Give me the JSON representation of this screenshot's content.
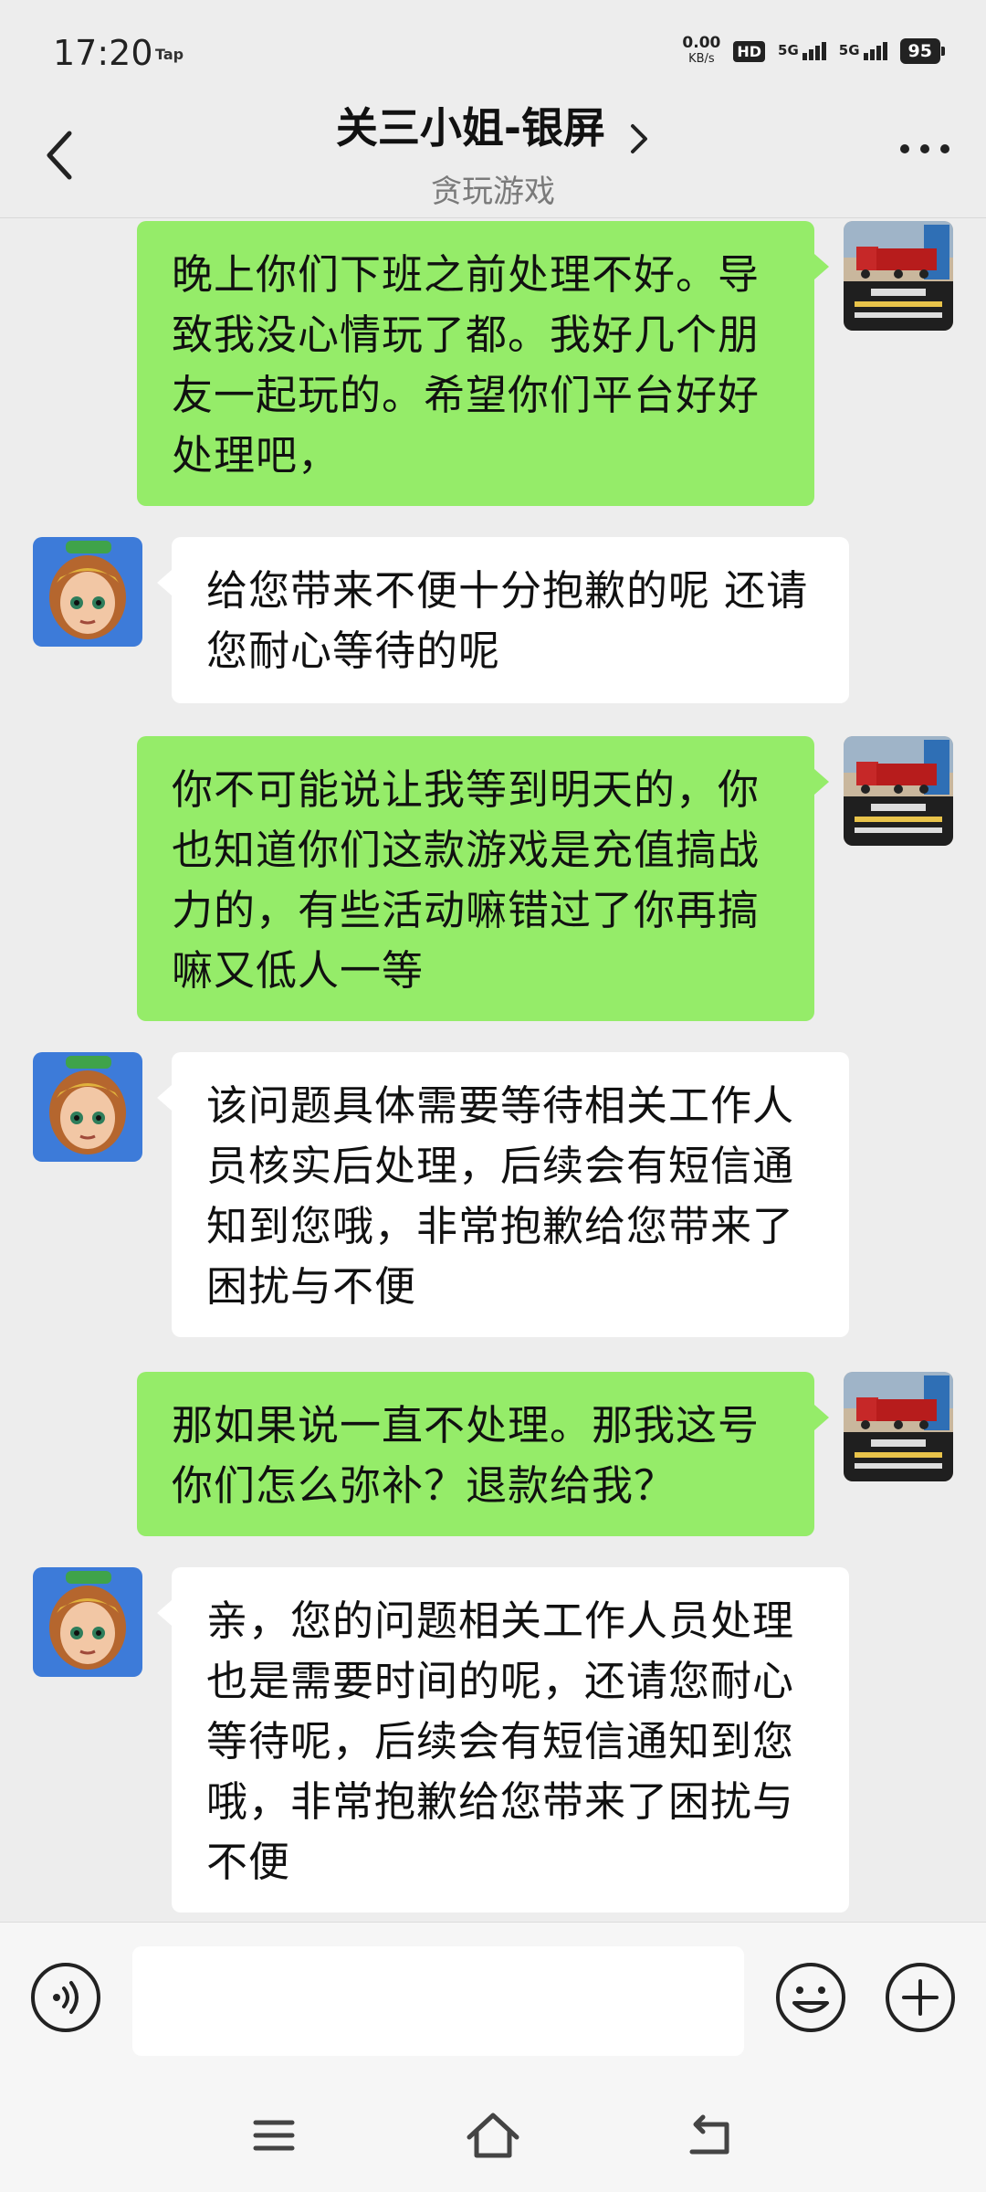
{
  "status_bar": {
    "time": "17:20",
    "tap_label": "Tap",
    "net_speed": "0.00",
    "net_unit": "KB/s",
    "hd_label": "HD",
    "sim1_label": "5G",
    "sim2_label": "5G",
    "battery": "95"
  },
  "header": {
    "title": "关三小姐-银屏",
    "subtitle": "贪玩游戏"
  },
  "messages": [
    {
      "sender": "me",
      "text": "晚上你们下班之前处理不好。导致我没心情玩了都。我好几个朋友一起玩的。希望你们平台好好处理吧，"
    },
    {
      "sender": "agent",
      "text": "给您带来不便十分抱歉的呢  还请您耐心等待的呢"
    },
    {
      "sender": "me",
      "text": "你不可能说让我等到明天的，你也知道你们这款游戏是充值搞战力的，有些活动嘛错过了你再搞嘛又低人一等"
    },
    {
      "sender": "agent",
      "text": "该问题具体需要等待相关工作人员核实后处理，后续会有短信通知到您哦，非常抱歉给您带来了困扰与不便"
    },
    {
      "sender": "me",
      "text": "那如果说一直不处理。那我这号你们怎么弥补？退款给我？"
    },
    {
      "sender": "agent",
      "text": "亲，您的问题相关工作人员处理也是需要时间的呢，还请您耐心等待呢，后续会有短信通知到您哦，非常抱歉给您带来了困扰与不便"
    }
  ],
  "input": {
    "value": "",
    "placeholder": ""
  },
  "colors": {
    "my_bubble": "#95ec69",
    "their_bubble": "#ffffff",
    "background": "#ededed"
  }
}
